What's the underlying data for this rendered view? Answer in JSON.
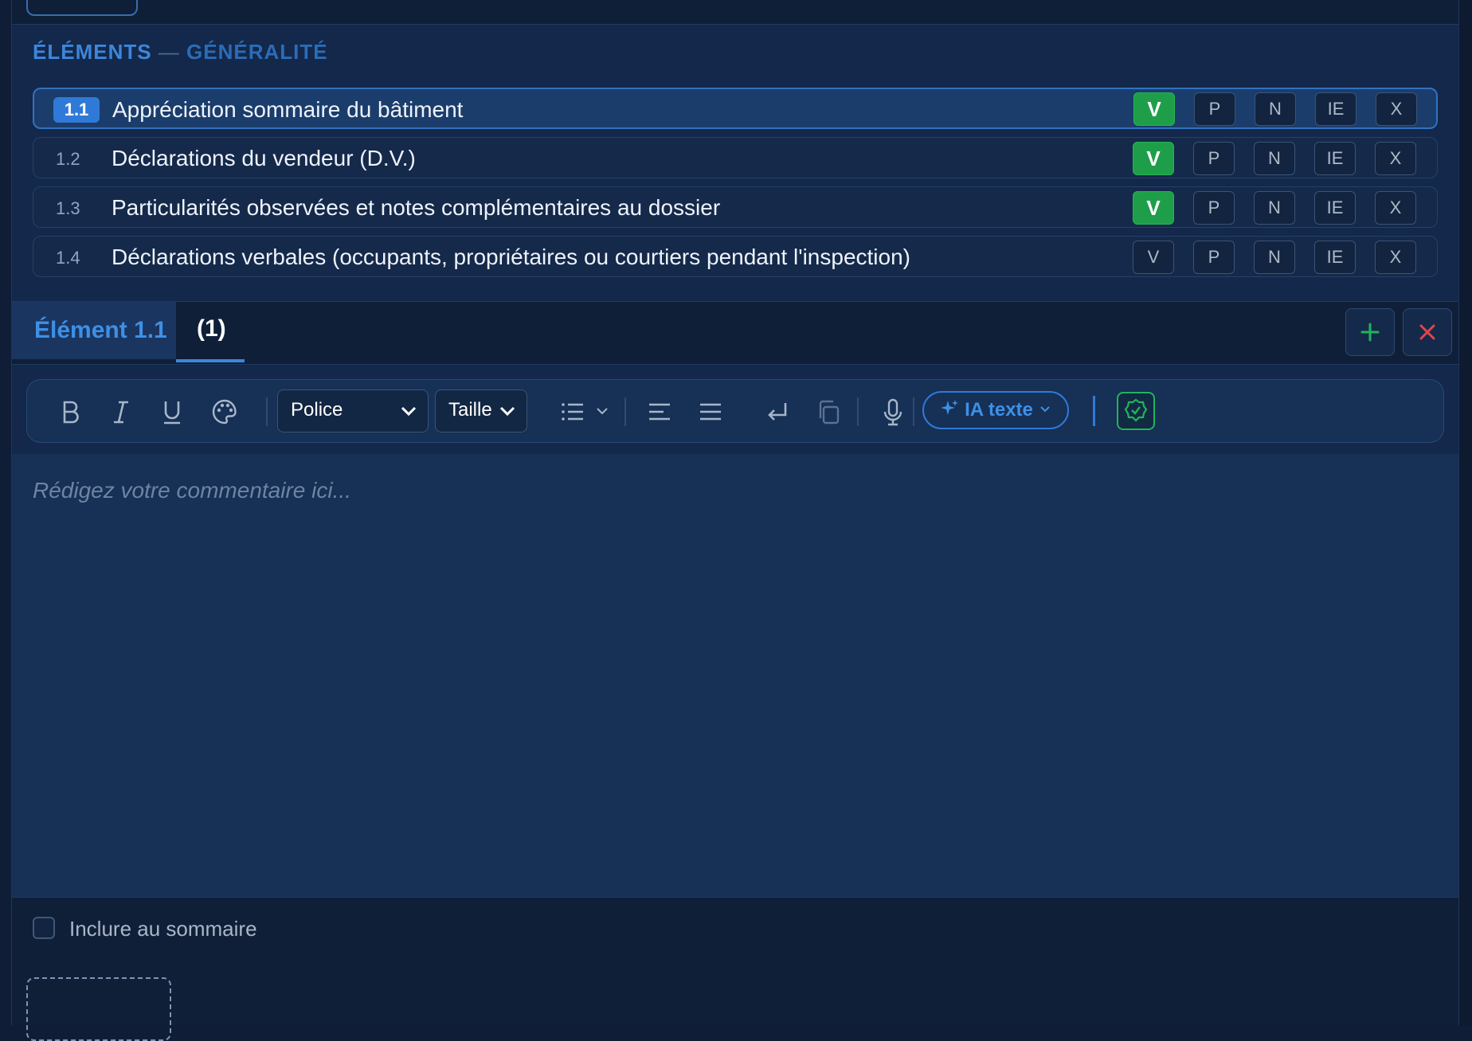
{
  "section": {
    "label_a": "ÉLÉMENTS",
    "separator": "—",
    "label_b": "GÉNÉRALITÉ"
  },
  "status_labels": [
    "V",
    "P",
    "N",
    "IE",
    "X"
  ],
  "elements": [
    {
      "num": "1.1",
      "label": "Appréciation sommaire du bâtiment",
      "selected": "V",
      "active": true
    },
    {
      "num": "1.2",
      "label": "Déclarations du vendeur (D.V.)",
      "selected": "V",
      "active": false
    },
    {
      "num": "1.3",
      "label": "Particularités observées et notes complémentaires au dossier",
      "selected": "V",
      "active": false
    },
    {
      "num": "1.4",
      "label": "Déclarations verbales (occupants, propriétaires ou courtiers pendant l'inspection)",
      "selected": "",
      "active": false
    }
  ],
  "tabs": {
    "element": "Élément 1.1",
    "count": "(1)"
  },
  "toolbar": {
    "font_select": "Police",
    "size_select": "Taille",
    "ai_button": "IA texte",
    "icons": [
      "bold-icon",
      "italic-icon",
      "underline-icon",
      "palette-icon",
      "list-icon",
      "align-left-icon",
      "justify-icon",
      "return-icon",
      "copy-icon",
      "microphone-icon",
      "sparkle-icon",
      "shield-check-icon"
    ]
  },
  "editor": {
    "placeholder": "Rédigez votre commentaire ici..."
  },
  "footer": {
    "checkbox_label": "Inclure au sommaire",
    "checked": false
  },
  "colors": {
    "accent": "#3d86dc",
    "success": "#1f9e4a",
    "danger": "#e0454d",
    "background": "#13284a"
  }
}
